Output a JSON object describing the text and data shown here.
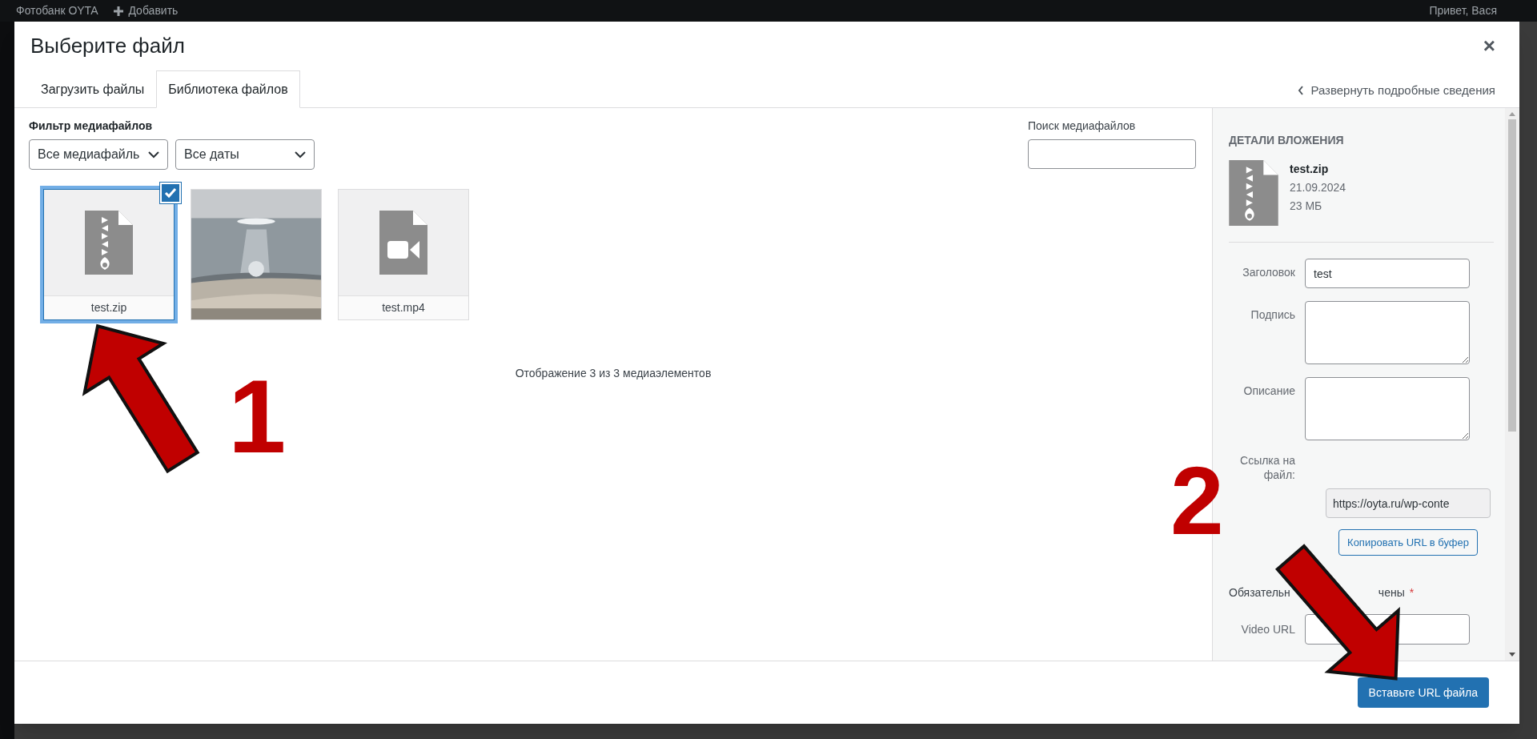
{
  "admin_bar": {
    "items": [
      "Фотобанк OYTA",
      "Добавить"
    ],
    "greeting": "Привет, Вася"
  },
  "modal": {
    "title": "Выберите файл",
    "close": "×",
    "tabs": [
      {
        "label": "Загрузить файлы",
        "selected": false
      },
      {
        "label": "Библиотека файлов",
        "selected": true
      }
    ],
    "expand_link": "Развернуть подробные сведения",
    "filter_label": "Фильтр медиафайлов",
    "filters": [
      "Все медиафайль",
      "Все даты"
    ],
    "search_label": "Поиск медиафайлов",
    "tiles": [
      {
        "kind": "zip",
        "name": "test.zip",
        "selected": true
      },
      {
        "kind": "picture",
        "selected": false
      },
      {
        "kind": "video",
        "name": "test.mp4",
        "selected": false
      }
    ],
    "count_text": "Отображение 3 из 3 медиаэлементов",
    "details": {
      "heading": "ДЕТАЛИ ВЛОЖЕНИЯ",
      "file_name": "test.zip",
      "date": "21.09.2024",
      "size": "23 МБ",
      "fields": [
        {
          "kind": "input",
          "label": "Заголовок",
          "value": "test"
        },
        {
          "kind": "textarea",
          "label": "Подпись"
        },
        {
          "kind": "textarea",
          "label": "Описание"
        },
        {
          "kind": "readonly",
          "label": "Ссылка на файл:",
          "value": "https://oyta.ru/wp-conte"
        }
      ],
      "copy_button": "Копировать URL в буфер",
      "required_note": [
        "Обязательн",
        "чены"
      ],
      "required_mark": "*",
      "video_label": "Video URL"
    },
    "insert_button": "Вставьте URL файла"
  },
  "annotations": [
    {
      "label": "1"
    },
    {
      "label": "2"
    }
  ]
}
